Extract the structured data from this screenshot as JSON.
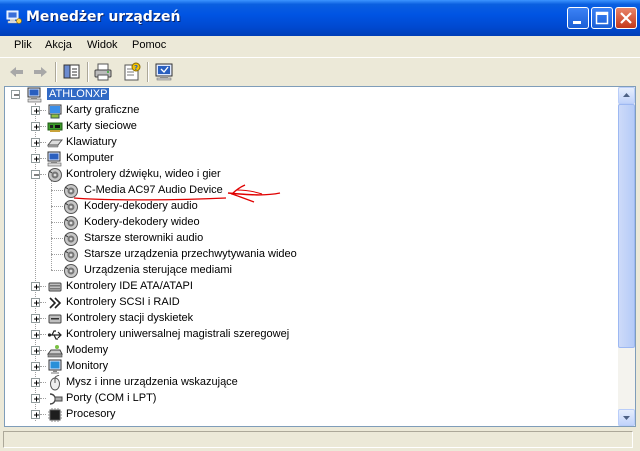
{
  "window": {
    "title": "Menedżer urządzeń"
  },
  "menu": [
    {
      "label": "Plik"
    },
    {
      "label": "Akcja"
    },
    {
      "label": "Widok"
    },
    {
      "label": "Pomoc"
    }
  ],
  "toolbar": {
    "buttons": [
      "back-arrow-icon",
      "forward-arrow-icon",
      "show-hide-console-tree-icon",
      "print-icon",
      "properties-help-icon",
      "scan-hardware-icon"
    ]
  },
  "tree": {
    "root": {
      "label": "ATHLONXP",
      "icon": "computer-icon",
      "selected": true
    },
    "items": [
      {
        "label": "Karty graficzne",
        "icon": "display-adapter-icon",
        "expander": "+"
      },
      {
        "label": "Karty sieciowe",
        "icon": "network-adapter-icon",
        "expander": "+"
      },
      {
        "label": "Klawiatury",
        "icon": "keyboard-icon",
        "expander": "+"
      },
      {
        "label": "Komputer",
        "icon": "computer-icon",
        "expander": "+"
      },
      {
        "label": "Kontrolery dźwięku, wideo i gier",
        "icon": "sound-icon",
        "expander": "-",
        "children": [
          {
            "label": "C-Media AC97 Audio Device",
            "icon": "sound-icon"
          },
          {
            "label": "Kodery-dekodery audio",
            "icon": "sound-icon"
          },
          {
            "label": "Kodery-dekodery wideo",
            "icon": "sound-icon"
          },
          {
            "label": "Starsze sterowniki audio",
            "icon": "sound-icon"
          },
          {
            "label": "Starsze urządzenia przechwytywania wideo",
            "icon": "sound-icon"
          },
          {
            "label": "Urządzenia sterujące mediami",
            "icon": "sound-icon"
          }
        ]
      },
      {
        "label": "Kontrolery IDE ATA/ATAPI",
        "icon": "ide-controller-icon",
        "expander": "+"
      },
      {
        "label": "Kontrolery SCSI i RAID",
        "icon": "scsi-controller-icon",
        "expander": "+"
      },
      {
        "label": "Kontrolery stacji dyskietek",
        "icon": "floppy-controller-icon",
        "expander": "+"
      },
      {
        "label": "Kontrolery uniwersalnej magistrali szeregowej",
        "icon": "usb-icon",
        "expander": "+"
      },
      {
        "label": "Modemy",
        "icon": "modem-icon",
        "expander": "+"
      },
      {
        "label": "Monitory",
        "icon": "monitor-icon",
        "expander": "+"
      },
      {
        "label": "Mysz i inne urządzenia wskazujące",
        "icon": "mouse-icon",
        "expander": "+"
      },
      {
        "label": "Porty (COM i LPT)",
        "icon": "port-icon",
        "expander": "+"
      },
      {
        "label": "Procesory",
        "icon": "processor-icon",
        "expander": "+"
      }
    ]
  },
  "colors": {
    "titlebar": "#0054e3",
    "selection": "#316ac5",
    "annotation": "#e00000"
  }
}
